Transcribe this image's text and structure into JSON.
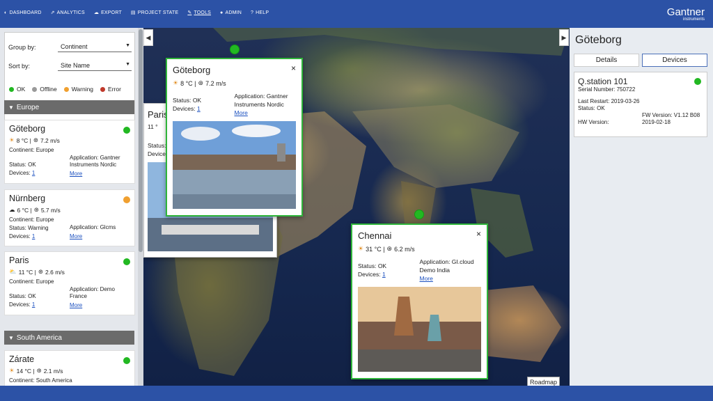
{
  "nav": [
    {
      "icon": "◐",
      "label": "DASHBOARD"
    },
    {
      "icon": "⇗",
      "label": "ANALYTICS"
    },
    {
      "icon": "☁",
      "label": "EXPORT"
    },
    {
      "icon": "▤",
      "label": "PROJECT STATE"
    },
    {
      "icon": "✎",
      "label": "TOOLS"
    },
    {
      "icon": "●",
      "label": "ADMIN"
    },
    {
      "icon": "?",
      "label": "HELP"
    }
  ],
  "brand": {
    "name": "Gantner",
    "sub": "instruments"
  },
  "filters": {
    "group_label": "Group by:",
    "group_value": "Continent",
    "sort_label": "Sort by:",
    "sort_value": "Site Name"
  },
  "legend": [
    {
      "label": "OK",
      "color": "#22b822"
    },
    {
      "label": "Offline",
      "color": "#9a9a9a"
    },
    {
      "label": "Warning",
      "color": "#f0a030"
    },
    {
      "label": "Error",
      "color": "#c0392b"
    }
  ],
  "groups": {
    "europe": "Europe",
    "south_america": "South America"
  },
  "sites": [
    {
      "name": "Göteborg",
      "temp": "8 °C |",
      "wind": "7.2 m/s",
      "continent": "Continent: Europe",
      "status": "Status: OK",
      "devices_label": "Devices:",
      "devices": "1",
      "app": "Application: Gantner Instruments Nordic",
      "more": "More",
      "color": "#22b822"
    },
    {
      "name": "Nürnberg",
      "temp": "6 °C |",
      "wind": "5.7 m/s",
      "continent": "Continent: Europe",
      "status": "Status: Warning",
      "devices_label": "Devices:",
      "devices": "1",
      "app": "Application: Glcms",
      "more": "More",
      "color": "#f0a030"
    },
    {
      "name": "Paris",
      "temp": "11 °C |",
      "wind": "2.6 m/s",
      "continent": "Continent: Europe",
      "status": "Status: OK",
      "devices_label": "Devices:",
      "devices": "1",
      "app": "Application: Demo France",
      "more": "More",
      "color": "#22b822"
    },
    {
      "name": "Zárate",
      "temp": "14 °C |",
      "wind": "2.1 m/s",
      "continent": "Continent: South America",
      "color": "#22b822"
    }
  ],
  "popups": {
    "goteborg": {
      "title": "Göteborg",
      "temp": "8 °C |",
      "wind": "7.2 m/s",
      "status": "Status: OK",
      "devices_label": "Devices:",
      "devices": "1",
      "app": "Application: Gantner Instruments Nordic",
      "more": "More",
      "close": "×"
    },
    "chennai": {
      "title": "Chennai",
      "temp": "31 °C |",
      "wind": "6.2 m/s",
      "status": "Status: OK",
      "devices_label": "Devices:",
      "devices": "1",
      "app": "Application: GI.cloud Demo India",
      "more": "More",
      "close": "×"
    },
    "paris_partial": {
      "title": "Paris",
      "temp": "11 °",
      "status": "Status:",
      "devices": "Devices"
    }
  },
  "map": {
    "roadmap": "Roadmap",
    "left_arrow": "◀",
    "right_arrow": "▶"
  },
  "right_panel": {
    "title": "Göteborg",
    "tabs": [
      "Details",
      "Devices"
    ],
    "device": {
      "name": "Q.station 101",
      "serial": "Serial Number: 750722",
      "restart": "Last Restart: 2019-03-26",
      "status": "Status: OK",
      "fw_label": "FW Version: V1.12 B08",
      "fw_date": "2019-02-18",
      "hw_label": "HW Version:"
    }
  }
}
